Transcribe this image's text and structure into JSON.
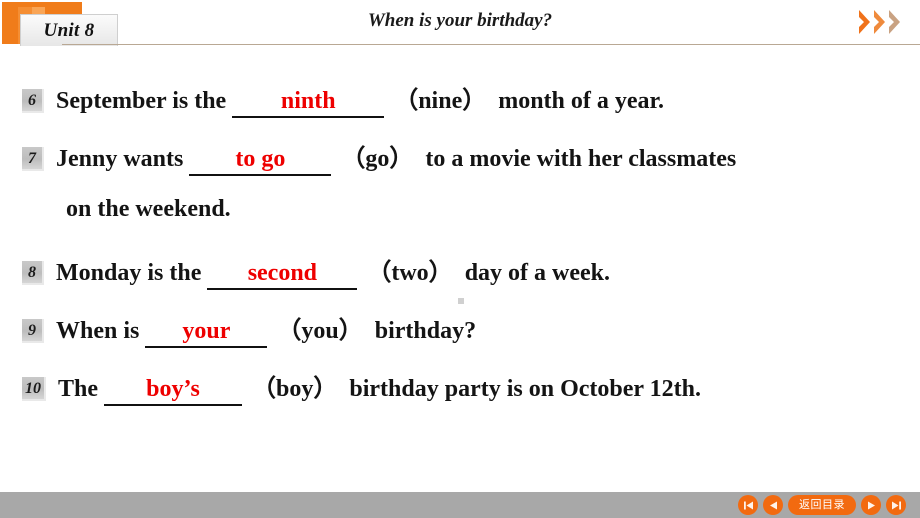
{
  "header": {
    "unit_tab_label": "Unit 8",
    "title": "When is your birthday?",
    "chevron_icon_name": "chevron-right-icon",
    "accent_color": "#f07c1a",
    "rule_color": "#b9a894"
  },
  "exercise": {
    "answer_color": "#ee0000",
    "text_color": "#141414",
    "items": [
      {
        "number": "6",
        "before": "September is the",
        "answer": "ninth",
        "cue": "（nine）",
        "after": "month of a year.",
        "continuation": ""
      },
      {
        "number": "7",
        "before": "Jenny wants",
        "answer": "to go",
        "cue": "（go）",
        "after": "to a movie with her classmates",
        "continuation": "on the weekend."
      },
      {
        "number": "8",
        "before": "Monday is the",
        "answer": "second",
        "cue": "（two）",
        "after": "day of a week.",
        "continuation": ""
      },
      {
        "number": "9",
        "before": "When is",
        "answer": "your",
        "cue": "（you）",
        "after": "birthday?",
        "continuation": ""
      },
      {
        "number": "10",
        "before": "The",
        "answer": "boy’s",
        "cue": "（boy）",
        "after": "birthday party is on October 12th.",
        "continuation": ""
      }
    ]
  },
  "footer": {
    "bar_color": "#a8a8a8",
    "button_color": "#f26a10",
    "home_label": "返回目录",
    "first_icon_name": "skip-to-first-icon",
    "prev_icon_name": "previous-slide-icon",
    "next_icon_name": "next-slide-icon",
    "last_icon_name": "skip-to-last-icon"
  }
}
